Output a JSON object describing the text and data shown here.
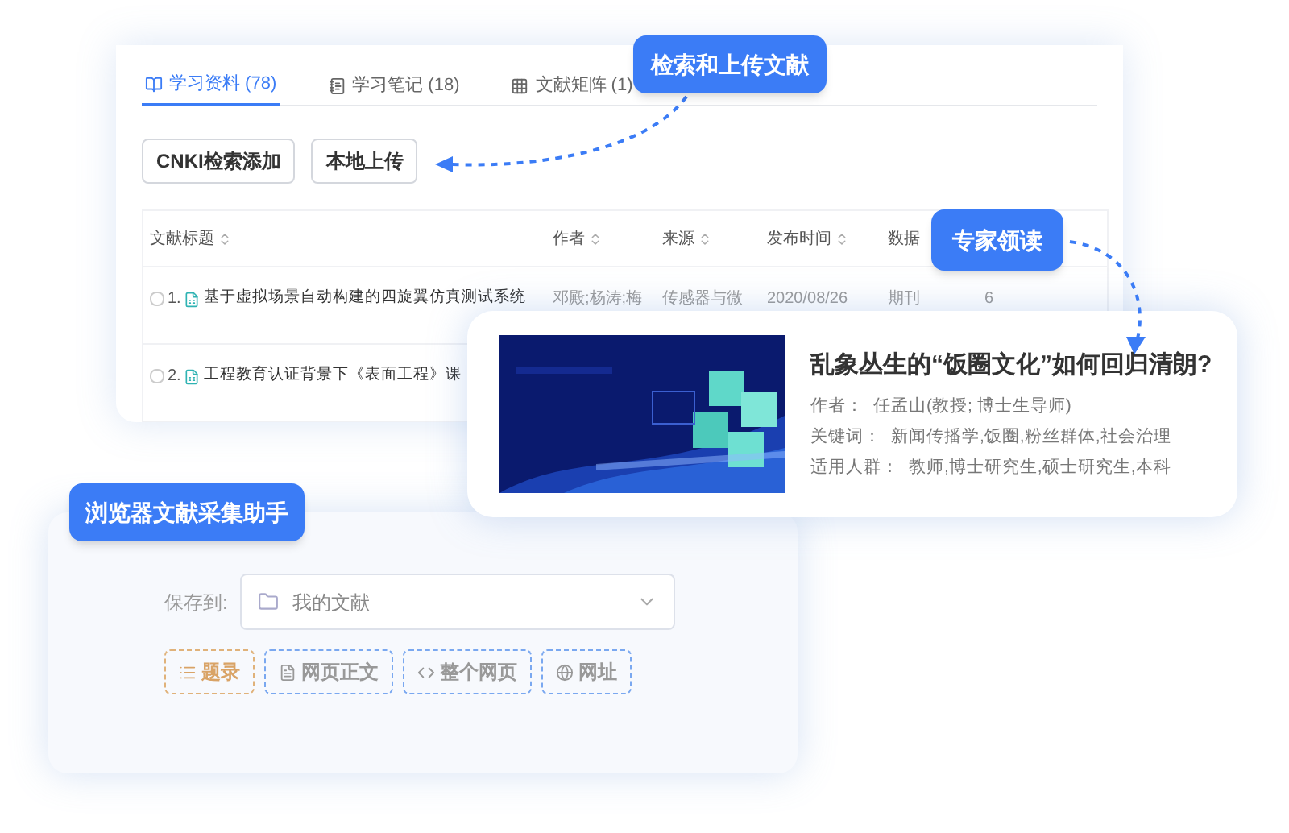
{
  "tabs": [
    {
      "label": "学习资料 (78)",
      "selected": true
    },
    {
      "label": "学习笔记 (18)",
      "selected": false
    },
    {
      "label": "文献矩阵 (1)",
      "selected": false
    }
  ],
  "buttons": [
    "CNKI检索添加",
    "本地上传"
  ],
  "table": {
    "columns": [
      "文献标题",
      "作者",
      "来源",
      "发布时间",
      "数据"
    ],
    "rows": [
      {
        "number": "1.",
        "title": "基于虚拟场景自动构建的四旋翼仿真测试系统",
        "checked": false,
        "cells": [
          "邓殿;杨涛;梅",
          "传感器与微",
          "2020/08/26",
          "期刊",
          "6"
        ]
      },
      {
        "number": "2.",
        "title": "工程教育认证背景下《表面工程》课",
        "checked": false
      }
    ]
  },
  "card": {
    "kind": "picture",
    "title": "乱象丛生的“饭圈文化”如何回归清朗?",
    "fields": [
      {
        "label": "作者：",
        "value": "任孟山(教授; 博士生导师)"
      },
      {
        "label": "关键词：",
        "value": "新闻传播学,饭圈,粉丝群体,社会治理"
      },
      {
        "label": "适用人群：",
        "value": "教师,博士研究生,硕士研究生,本科"
      }
    ]
  },
  "collector": {
    "label": "保存到:",
    "select": {
      "value": "我的文献"
    },
    "chips": [
      {
        "label": "题录",
        "selected": true
      },
      {
        "label": "网页正文",
        "selected": false
      },
      {
        "label": "整个网页",
        "selected": false
      },
      {
        "label": "网址",
        "selected": false
      }
    ]
  },
  "callouts": [
    {
      "label": "检索和上传文献"
    },
    {
      "label": "专家领读"
    },
    {
      "label": "浏览器文献采集助手"
    }
  ]
}
